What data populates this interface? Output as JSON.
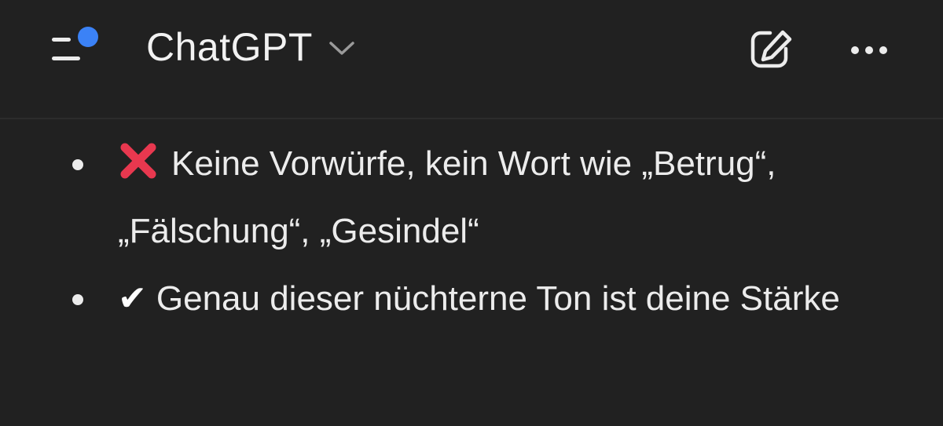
{
  "header": {
    "title": "ChatGPT",
    "icons": {
      "menu": "sidebar-menu-icon",
      "notification_dot_color": "#3b82f6",
      "title_chevron": "chevron-down-icon",
      "new_chat": "new-chat-edit-icon",
      "more": "more-horizontal-icon"
    }
  },
  "message": {
    "bullets": [
      {
        "icon": "cross-mark-emoji",
        "text": "Keine Vorwürfe, kein Wort wie „Betrug“, „Fälschung“, „Gesindel“"
      },
      {
        "icon": "check-mark-emoji",
        "icon_glyph": "✔",
        "text": "Genau dieser nüchterne Ton ist deine Stärke"
      }
    ]
  },
  "colors": {
    "background": "#212121",
    "text": "#ececec",
    "cross_mark": "#e8384f"
  }
}
